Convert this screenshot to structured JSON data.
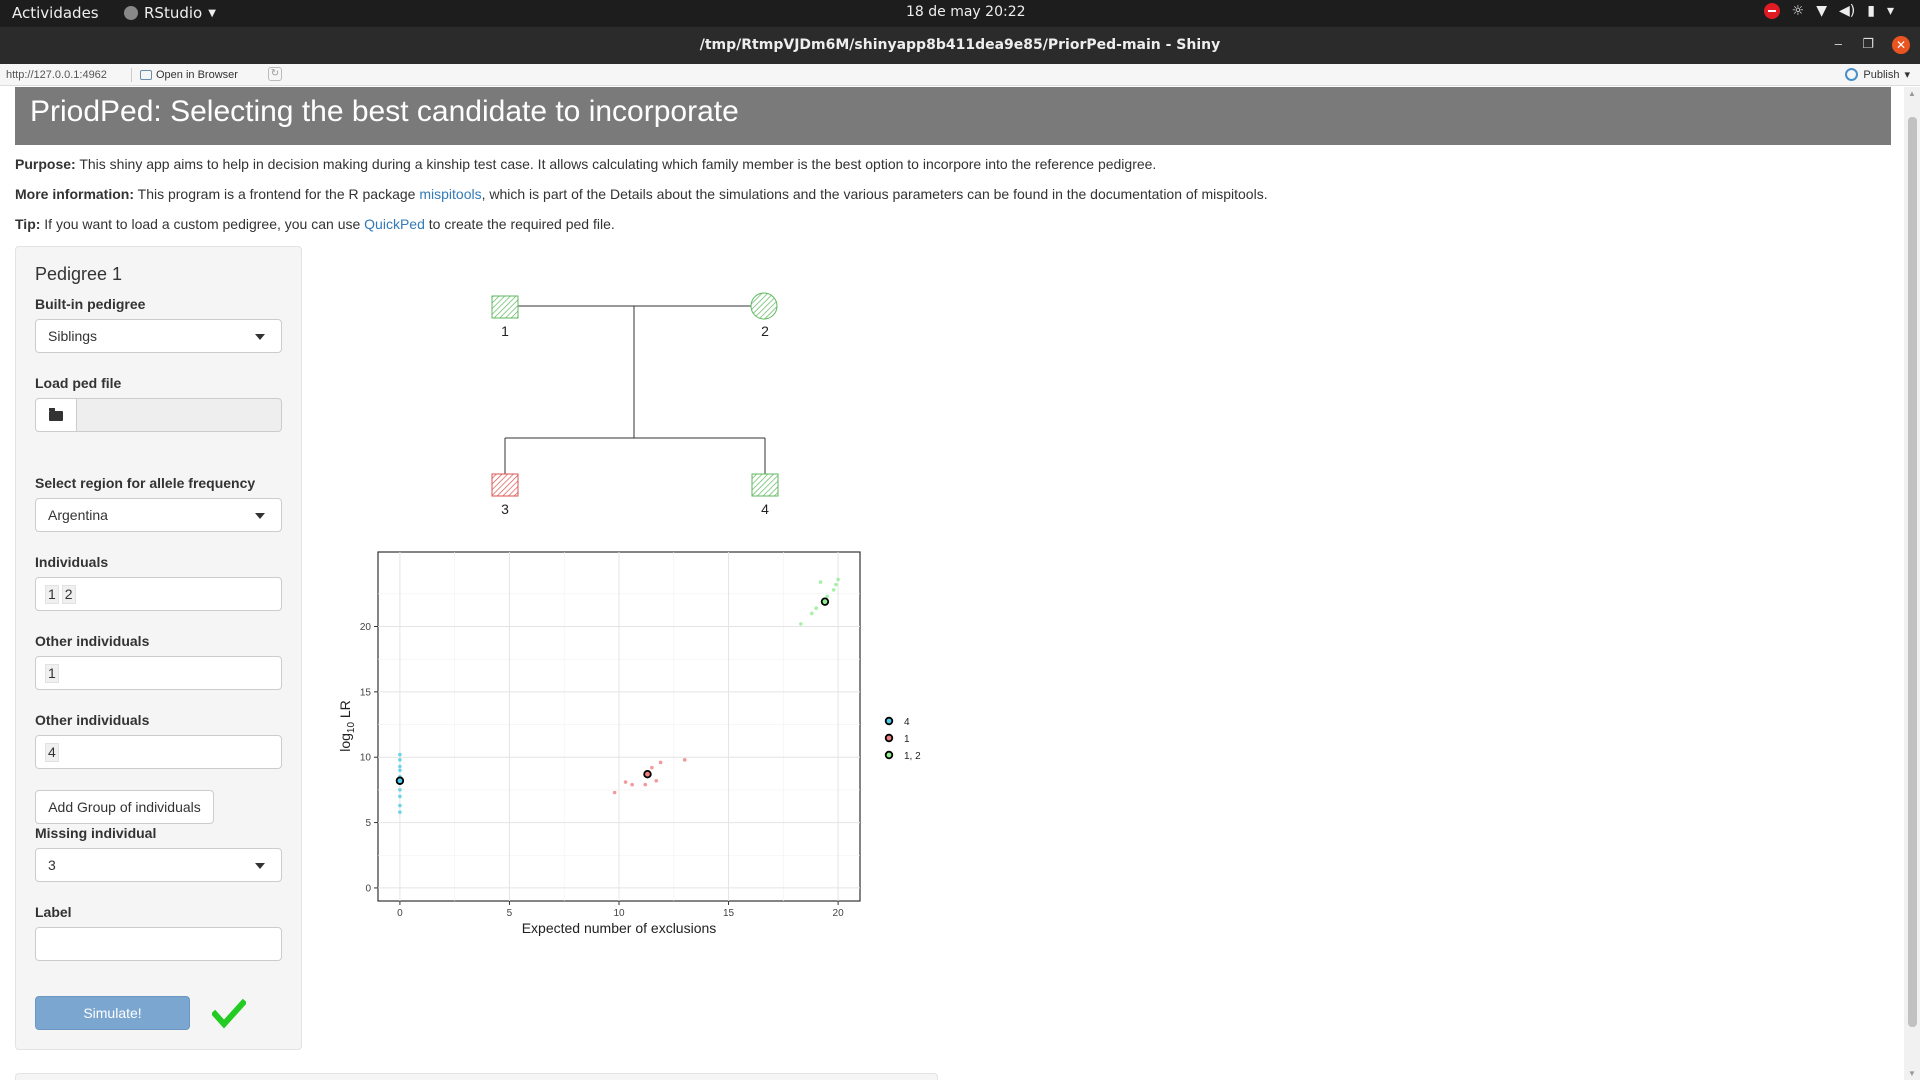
{
  "topbar": {
    "activities": "Actividades",
    "app_name": "RStudio",
    "clock": "18 de may  20:22"
  },
  "window": {
    "title": "/tmp/RtmpVJDm6M/shinyapp8b411dea9e85/PriorPed-main - Shiny"
  },
  "viewer": {
    "url": "http://127.0.0.1:4962",
    "open_in_browser": "Open in Browser",
    "publish": "Publish"
  },
  "page": {
    "title": "PriodPed: Selecting the best candidate to incorporate",
    "purpose_label": "Purpose:",
    "purpose_text": " This shiny app aims to help in decision making during a kinship test case. It allows calculating which family member is the best option to incorpore into the reference pedigree.",
    "more_label": "More information:",
    "more_text_1": " This program is a frontend for the R package ",
    "more_link": "mispitools",
    "more_text_2": ", which is part of the Details about the simulations and the various parameters can be found in the documentation of mispitools.",
    "tip_label": "Tip:",
    "tip_text_1": " If you want to load a custom pedigree, you can use ",
    "tip_link": "QuickPed",
    "tip_text_2": " to create the required ped file."
  },
  "sidebar": {
    "heading": "Pedigree 1",
    "builtin_label": "Built-in pedigree",
    "builtin_value": "Siblings",
    "load_label": "Load ped file",
    "region_label": "Select region for allele frequency",
    "region_value": "Argentina",
    "individuals_label": "Individuals",
    "individuals_tokens": [
      "1",
      "2"
    ],
    "other1_label": "Other individuals",
    "other1_tokens": [
      "1"
    ],
    "other2_label": "Other individuals",
    "other2_tokens": [
      "4"
    ],
    "add_group_button": "Add Group of individuals",
    "missing_label": "Missing individual",
    "missing_value": "3",
    "label_label": "Label",
    "label_value": "",
    "simulate_button": "Simulate!"
  },
  "pedigree": {
    "individuals": [
      {
        "id": "1",
        "sex": "male",
        "status": "typed"
      },
      {
        "id": "2",
        "sex": "female",
        "status": "typed"
      },
      {
        "id": "3",
        "sex": "male",
        "status": "missing"
      },
      {
        "id": "4",
        "sex": "male",
        "status": "typed"
      }
    ],
    "colors": {
      "typed": "#5cb85c",
      "missing": "#d9534f"
    }
  },
  "chart_data": {
    "type": "scatter",
    "xlabel": "Expected number of exclusions",
    "ylabel": "log10 LR",
    "xlim": [
      -1,
      21
    ],
    "ylim": [
      -1,
      25.7
    ],
    "xticks": [
      0,
      5,
      10,
      15,
      20
    ],
    "yticks": [
      0,
      5,
      10,
      15,
      20
    ],
    "grid": true,
    "legend_position": "right",
    "series": [
      {
        "name": "4",
        "color": "#4ec9e8",
        "points": [
          [
            0,
            5.8
          ],
          [
            0,
            6.3
          ],
          [
            0,
            7.0
          ],
          [
            0,
            7.5
          ],
          [
            0,
            8.0
          ],
          [
            0,
            8.5
          ],
          [
            0,
            9.0
          ],
          [
            0,
            9.3
          ],
          [
            0,
            9.8
          ],
          [
            0,
            10.2
          ]
        ],
        "mean": [
          0,
          8.2
        ]
      },
      {
        "name": "1",
        "color": "#f08080",
        "points": [
          [
            9.8,
            7.3
          ],
          [
            10.3,
            8.1
          ],
          [
            10.6,
            7.9
          ],
          [
            11.2,
            7.9
          ],
          [
            11.3,
            8.6
          ],
          [
            11.5,
            9.2
          ],
          [
            11.7,
            8.2
          ],
          [
            11.9,
            9.6
          ],
          [
            13.0,
            9.8
          ]
        ],
        "mean": [
          11.3,
          8.7
        ]
      },
      {
        "name": "1, 2",
        "color": "#90ee90",
        "points": [
          [
            18.3,
            20.2
          ],
          [
            18.8,
            21.0
          ],
          [
            19.0,
            21.4
          ],
          [
            19.2,
            23.4
          ],
          [
            19.5,
            22.3
          ],
          [
            19.8,
            22.8
          ],
          [
            19.9,
            23.2
          ],
          [
            20.0,
            23.6
          ]
        ],
        "mean": [
          19.4,
          21.9
        ]
      }
    ]
  }
}
